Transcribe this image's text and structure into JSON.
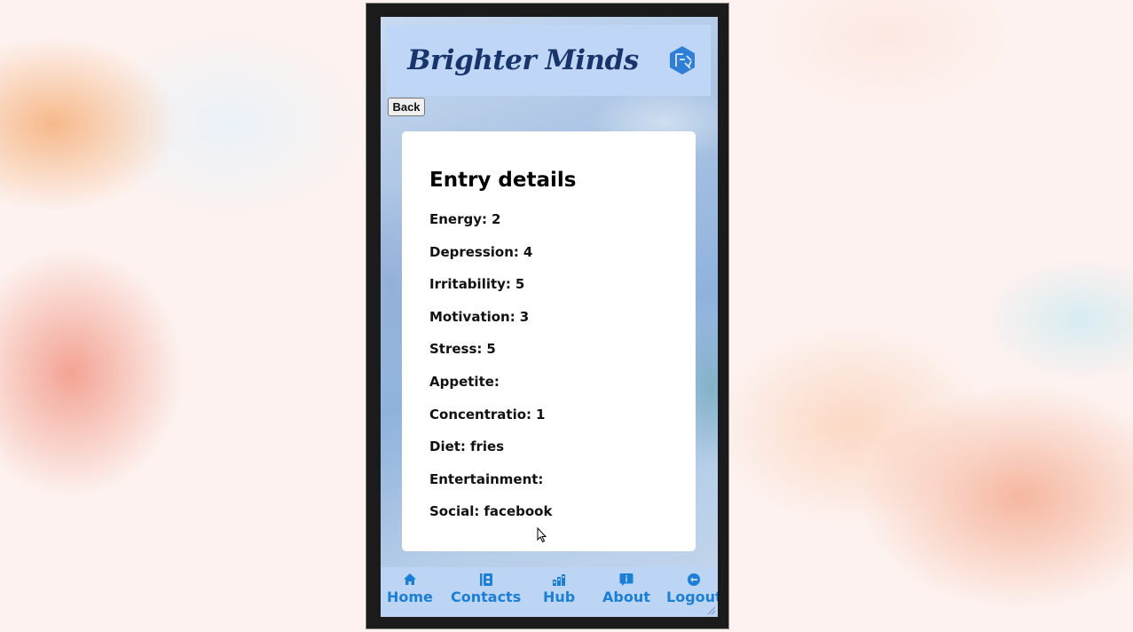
{
  "app": {
    "brand": "Brighter Minds",
    "back_label": "Back"
  },
  "entry": {
    "title": "Entry details",
    "fields": [
      {
        "label": "Energy:",
        "value": "2"
      },
      {
        "label": "Depression:",
        "value": "4"
      },
      {
        "label": "Irritability:",
        "value": "5"
      },
      {
        "label": "Motivation:",
        "value": "3"
      },
      {
        "label": "Stress:",
        "value": "5"
      },
      {
        "label": "Appetite:",
        "value": ""
      },
      {
        "label": "Concentratio:",
        "value": "1"
      },
      {
        "label": "Diet:",
        "value": "fries"
      },
      {
        "label": "Entertainment:",
        "value": ""
      },
      {
        "label": "Social:",
        "value": "facebook"
      }
    ]
  },
  "nav": {
    "items": [
      {
        "label": "Home",
        "icon": "home-icon"
      },
      {
        "label": "Contacts",
        "icon": "contacts-icon"
      },
      {
        "label": "Hub",
        "icon": "hub-icon"
      },
      {
        "label": "About",
        "icon": "about-icon"
      },
      {
        "label": "Logout",
        "icon": "logout-icon"
      }
    ]
  },
  "colors": {
    "header_bg": "#bfd6f6",
    "brand_text": "#17356b",
    "nav_bg": "#bcd5f5",
    "nav_accent": "#1c7fd6",
    "card_bg": "#ffffff"
  }
}
